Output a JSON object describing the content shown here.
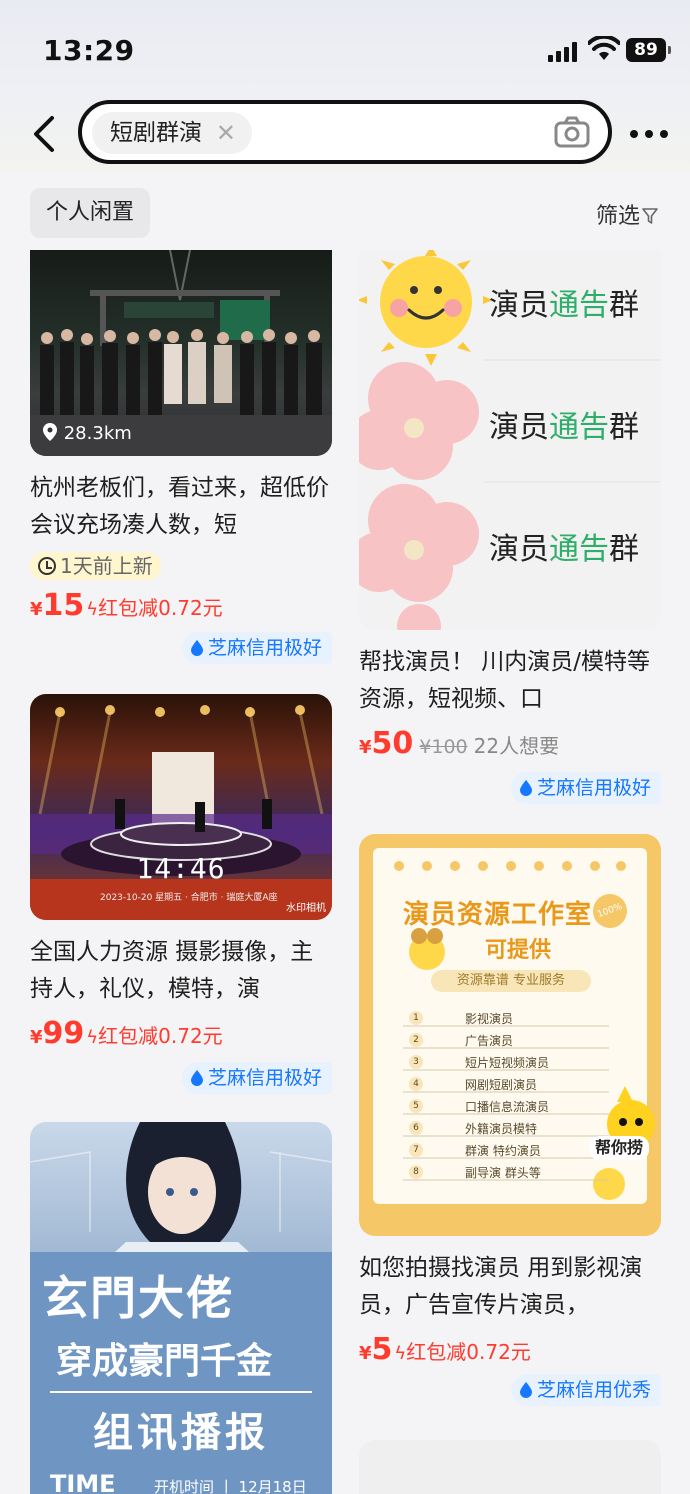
{
  "status": {
    "time": "13:29",
    "battery": "89"
  },
  "header": {
    "search_query": "短剧群演",
    "clear_icon": "✕"
  },
  "filters": {
    "chip": "个人闲置",
    "filter_label": "筛选"
  },
  "left": [
    {
      "distance": "28.3km",
      "title": "杭州老板们，看过来，超低价会议充场凑人数，短",
      "new_label": "1天前上新",
      "yen": "¥",
      "price": "15",
      "bonus": "红包减0.72元",
      "credit": "芝麻信用极好"
    },
    {
      "overlay_time": "14:46",
      "overlay_sub": "2023-10-20 星期五 · 合肥市 · 瑞庭大厦A座",
      "watermark": "水印相机",
      "title": "全国人力资源 摄影摄像，主持人，礼仪，模特，演",
      "yen": "¥",
      "price": "99",
      "bonus": "红包减0.72元",
      "credit": "芝麻信用极好"
    },
    {
      "poster_title_1": "玄門大佬",
      "poster_title_2": "穿成豪門千金",
      "poster_banner": "组讯播报",
      "poster_time_label": "TIME",
      "poster_time_text": "开机时间 丨 12月18日"
    }
  ],
  "right": [
    {
      "group_lines": [
        {
          "a": "演员",
          "b": "通告",
          "c": "群"
        },
        {
          "a": "演员",
          "b": "通告",
          "c": "群"
        },
        {
          "a": "演员",
          "b": "通告",
          "c": "群"
        }
      ],
      "title": "帮找演员！ 川内演员/模特等资源，短视频、口",
      "yen": "¥",
      "price": "50",
      "orig_price": "¥100",
      "want": "22人想要",
      "credit": "芝麻信用极好"
    },
    {
      "poster_heading": "演员资源工作室",
      "poster_sub": "可提供",
      "poster_tag": "100%",
      "poster_slogan": "资源靠谱 专业服务",
      "poster_items": [
        {
          "n": "1",
          "t": "影视演员"
        },
        {
          "n": "2",
          "t": "广告演员"
        },
        {
          "n": "3",
          "t": "短片短视频演员"
        },
        {
          "n": "4",
          "t": "网剧短剧演员"
        },
        {
          "n": "5",
          "t": "口播信息流演员"
        },
        {
          "n": "6",
          "t": "外籍演员模特"
        },
        {
          "n": "7",
          "t": "群演 特约演员"
        },
        {
          "n": "8",
          "t": "副导演 群头等"
        }
      ],
      "poster_mascot": "帮你捞",
      "title": "如您拍摄找演员 用到影视演员，广告宣传片演员，",
      "yen": "¥",
      "price": "5",
      "bonus": "红包减0.72元",
      "credit": "芝麻信用优秀"
    }
  ],
  "colors": {
    "price_red": "#ff3b2e",
    "credit_blue": "#1677ff",
    "credit_bg": "#e8f2ff"
  }
}
